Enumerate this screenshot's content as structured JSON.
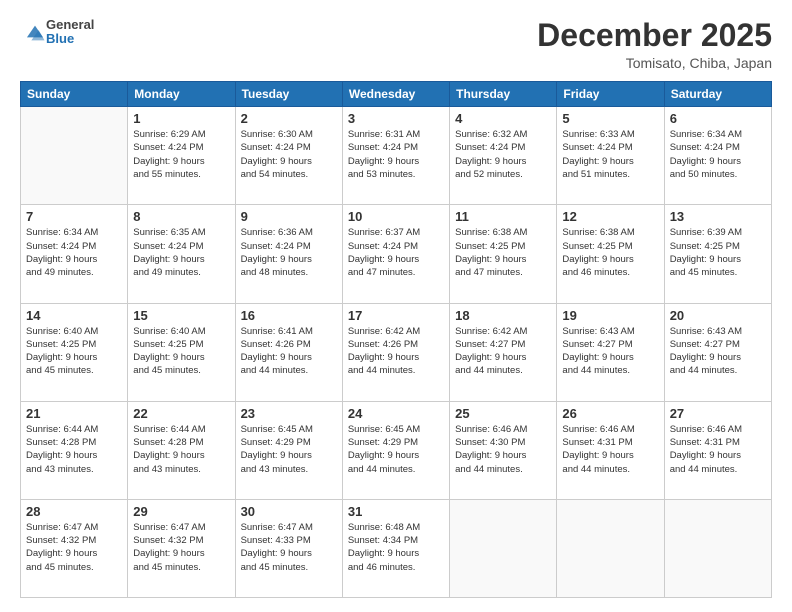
{
  "header": {
    "logo_general": "General",
    "logo_blue": "Blue",
    "month_title": "December 2025",
    "location": "Tomisato, Chiba, Japan"
  },
  "weekdays": [
    "Sunday",
    "Monday",
    "Tuesday",
    "Wednesday",
    "Thursday",
    "Friday",
    "Saturday"
  ],
  "weeks": [
    [
      {
        "day": "",
        "info": ""
      },
      {
        "day": "1",
        "info": "Sunrise: 6:29 AM\nSunset: 4:24 PM\nDaylight: 9 hours\nand 55 minutes."
      },
      {
        "day": "2",
        "info": "Sunrise: 6:30 AM\nSunset: 4:24 PM\nDaylight: 9 hours\nand 54 minutes."
      },
      {
        "day": "3",
        "info": "Sunrise: 6:31 AM\nSunset: 4:24 PM\nDaylight: 9 hours\nand 53 minutes."
      },
      {
        "day": "4",
        "info": "Sunrise: 6:32 AM\nSunset: 4:24 PM\nDaylight: 9 hours\nand 52 minutes."
      },
      {
        "day": "5",
        "info": "Sunrise: 6:33 AM\nSunset: 4:24 PM\nDaylight: 9 hours\nand 51 minutes."
      },
      {
        "day": "6",
        "info": "Sunrise: 6:34 AM\nSunset: 4:24 PM\nDaylight: 9 hours\nand 50 minutes."
      }
    ],
    [
      {
        "day": "7",
        "info": "Sunrise: 6:34 AM\nSunset: 4:24 PM\nDaylight: 9 hours\nand 49 minutes."
      },
      {
        "day": "8",
        "info": "Sunrise: 6:35 AM\nSunset: 4:24 PM\nDaylight: 9 hours\nand 49 minutes."
      },
      {
        "day": "9",
        "info": "Sunrise: 6:36 AM\nSunset: 4:24 PM\nDaylight: 9 hours\nand 48 minutes."
      },
      {
        "day": "10",
        "info": "Sunrise: 6:37 AM\nSunset: 4:24 PM\nDaylight: 9 hours\nand 47 minutes."
      },
      {
        "day": "11",
        "info": "Sunrise: 6:38 AM\nSunset: 4:25 PM\nDaylight: 9 hours\nand 47 minutes."
      },
      {
        "day": "12",
        "info": "Sunrise: 6:38 AM\nSunset: 4:25 PM\nDaylight: 9 hours\nand 46 minutes."
      },
      {
        "day": "13",
        "info": "Sunrise: 6:39 AM\nSunset: 4:25 PM\nDaylight: 9 hours\nand 45 minutes."
      }
    ],
    [
      {
        "day": "14",
        "info": "Sunrise: 6:40 AM\nSunset: 4:25 PM\nDaylight: 9 hours\nand 45 minutes."
      },
      {
        "day": "15",
        "info": "Sunrise: 6:40 AM\nSunset: 4:25 PM\nDaylight: 9 hours\nand 45 minutes."
      },
      {
        "day": "16",
        "info": "Sunrise: 6:41 AM\nSunset: 4:26 PM\nDaylight: 9 hours\nand 44 minutes."
      },
      {
        "day": "17",
        "info": "Sunrise: 6:42 AM\nSunset: 4:26 PM\nDaylight: 9 hours\nand 44 minutes."
      },
      {
        "day": "18",
        "info": "Sunrise: 6:42 AM\nSunset: 4:27 PM\nDaylight: 9 hours\nand 44 minutes."
      },
      {
        "day": "19",
        "info": "Sunrise: 6:43 AM\nSunset: 4:27 PM\nDaylight: 9 hours\nand 44 minutes."
      },
      {
        "day": "20",
        "info": "Sunrise: 6:43 AM\nSunset: 4:27 PM\nDaylight: 9 hours\nand 44 minutes."
      }
    ],
    [
      {
        "day": "21",
        "info": "Sunrise: 6:44 AM\nSunset: 4:28 PM\nDaylight: 9 hours\nand 43 minutes."
      },
      {
        "day": "22",
        "info": "Sunrise: 6:44 AM\nSunset: 4:28 PM\nDaylight: 9 hours\nand 43 minutes."
      },
      {
        "day": "23",
        "info": "Sunrise: 6:45 AM\nSunset: 4:29 PM\nDaylight: 9 hours\nand 43 minutes."
      },
      {
        "day": "24",
        "info": "Sunrise: 6:45 AM\nSunset: 4:29 PM\nDaylight: 9 hours\nand 44 minutes."
      },
      {
        "day": "25",
        "info": "Sunrise: 6:46 AM\nSunset: 4:30 PM\nDaylight: 9 hours\nand 44 minutes."
      },
      {
        "day": "26",
        "info": "Sunrise: 6:46 AM\nSunset: 4:31 PM\nDaylight: 9 hours\nand 44 minutes."
      },
      {
        "day": "27",
        "info": "Sunrise: 6:46 AM\nSunset: 4:31 PM\nDaylight: 9 hours\nand 44 minutes."
      }
    ],
    [
      {
        "day": "28",
        "info": "Sunrise: 6:47 AM\nSunset: 4:32 PM\nDaylight: 9 hours\nand 45 minutes."
      },
      {
        "day": "29",
        "info": "Sunrise: 6:47 AM\nSunset: 4:32 PM\nDaylight: 9 hours\nand 45 minutes."
      },
      {
        "day": "30",
        "info": "Sunrise: 6:47 AM\nSunset: 4:33 PM\nDaylight: 9 hours\nand 45 minutes."
      },
      {
        "day": "31",
        "info": "Sunrise: 6:48 AM\nSunset: 4:34 PM\nDaylight: 9 hours\nand 46 minutes."
      },
      {
        "day": "",
        "info": ""
      },
      {
        "day": "",
        "info": ""
      },
      {
        "day": "",
        "info": ""
      }
    ]
  ]
}
